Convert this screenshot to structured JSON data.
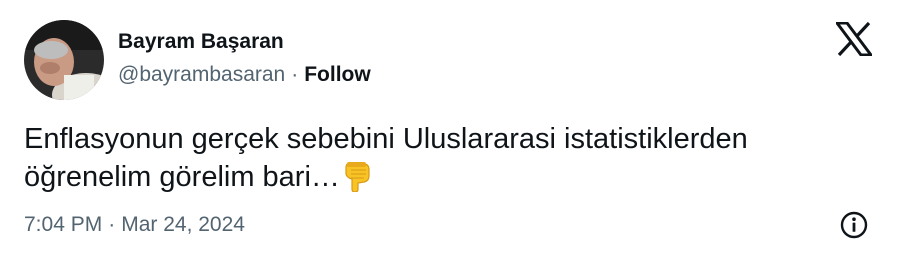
{
  "author": {
    "name": "Bayram Başaran",
    "handle": "@bayrambasaran",
    "separator": "·",
    "follow_label": "Follow",
    "avatar_icon": "avatar-photo"
  },
  "platform": {
    "logo_icon": "x-logo-icon"
  },
  "tweet": {
    "line1": "Enflasyonun gerçek sebebini Uluslararasi istatistiklerden",
    "line2": "öğrenelim görelim bari…",
    "emoji_icon": "pointing-down-icon"
  },
  "meta": {
    "time": "7:04 PM",
    "separator": "·",
    "date": "Mar 24, 2024",
    "info_icon": "info-icon"
  },
  "colors": {
    "text": "#0f1419",
    "secondary": "#536471",
    "background": "#ffffff",
    "emoji": "#f7c325"
  }
}
